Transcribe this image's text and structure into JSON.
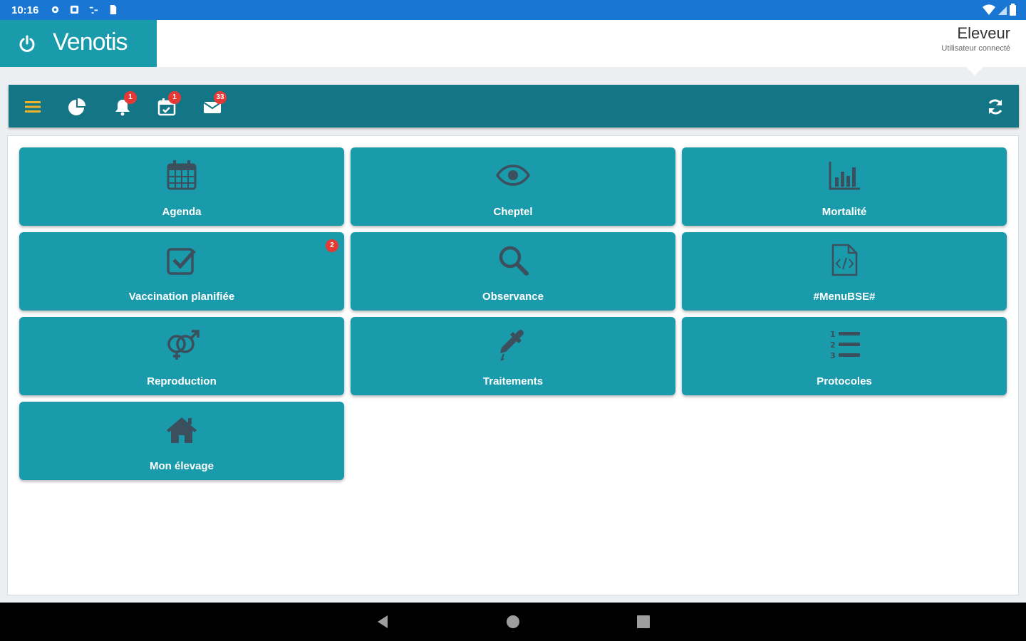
{
  "status_bar": {
    "time": "10:16"
  },
  "header": {
    "brand": "Venotis",
    "user_name": "Eleveur",
    "user_subtitle": "Utilisateur connecté"
  },
  "toolbar": {
    "notifications_badge": "1",
    "calendar_badge": "1",
    "messages_badge": "33"
  },
  "tiles": [
    {
      "label": "Agenda",
      "icon": "calendar-icon"
    },
    {
      "label": "Cheptel",
      "icon": "eye-icon"
    },
    {
      "label": "Mortalité",
      "icon": "bar-chart-icon"
    },
    {
      "label": "Vaccination planifiée",
      "icon": "checkbox-icon",
      "badge": "2"
    },
    {
      "label": "Observance",
      "icon": "search-icon"
    },
    {
      "label": "#MenuBSE#",
      "icon": "code-file-icon"
    },
    {
      "label": "Reproduction",
      "icon": "gender-icon"
    },
    {
      "label": "Traitements",
      "icon": "eyedropper-icon"
    },
    {
      "label": "Protocoles",
      "icon": "numbered-list-icon"
    },
    {
      "label": "Mon élevage",
      "icon": "home-icon"
    }
  ],
  "colors": {
    "status_bar": "#1976d2",
    "brand": "#1a9bac",
    "toolbar": "#137585",
    "tile": "#1a9bac",
    "icon": "#3b4f5c",
    "badge": "#e53935",
    "menu_icon": "#f0b429"
  }
}
